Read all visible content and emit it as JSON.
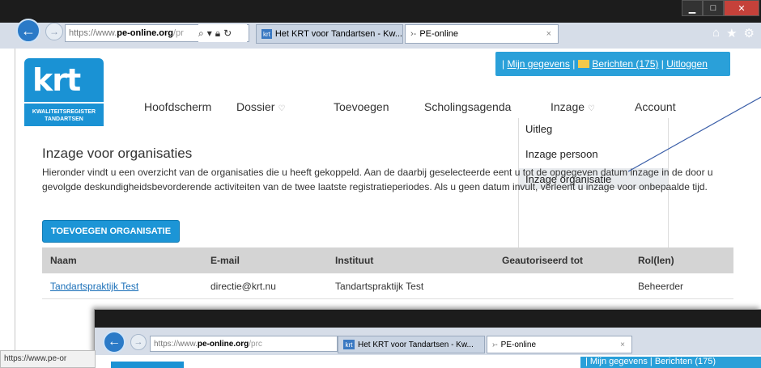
{
  "browser": {
    "address_prefix": "https://www.",
    "address_domain": "pe-online.org",
    "address_suffix": "/pr",
    "tab1_title": "Het KRT voor Tandartsen - Kw...",
    "tab2_title": "PE-online",
    "tab_close": "×",
    "status_url": "https://www.pe-or"
  },
  "header": {
    "links": {
      "my_data": "Mijn gegevens",
      "messages": "Berichten (175)",
      "logout": "Uitloggen",
      "sep": "|"
    },
    "logo": {
      "text": "krt",
      "subtitle_line1": "KWALITEITSREGISTER",
      "subtitle_line2": "TANDARTSEN"
    }
  },
  "nav": {
    "items": [
      {
        "label": "Hoofdscherm"
      },
      {
        "label": "Dossier"
      },
      {
        "label": "Toevoegen"
      },
      {
        "label": "Scholingsagenda"
      },
      {
        "label": "Inzage"
      },
      {
        "label": "Account"
      }
    ],
    "dropdown": [
      {
        "label": "Uitleg"
      },
      {
        "label": "Inzage persoon"
      },
      {
        "label": "Inzage organisatie"
      }
    ]
  },
  "main": {
    "title": "Inzage voor organisaties",
    "paragraph": "Hieronder vindt u een overzicht van de organisaties die u heeft gekoppeld. Aan de daarbij geselecteerde                                        eent u tot de opgegeven datum inzage in de door u gevolgde deskundigheidsbevorderende activiteiten van de twee laatste registratieperiodes. Als u geen datum invult, verleent u inzage voor onbepaalde tijd.",
    "add_button": "TOEVOEGEN ORGANISATIE",
    "table": {
      "headers": [
        "Naam",
        "E-mail",
        "Instituut",
        "Geautoriseerd tot",
        "Rol(len)"
      ],
      "rows": [
        [
          "Tandartspraktijk Test",
          "directie@krt.nu",
          "Tandartspraktijk Test",
          "",
          "Beheerder"
        ]
      ]
    }
  },
  "overlay": {
    "address_prefix": "https://www.",
    "address_domain": "pe-online.org",
    "address_suffix": "/prc",
    "tab1_title": "Het KRT voor Tandartsen - Kw...",
    "tab2_title": "PE-online",
    "tab_close": "×",
    "topbar_text": "| Mijn gegevens | Berichten (175)"
  },
  "icons": {
    "back": "back-arrow-icon",
    "forward": "forward-arrow-icon",
    "search": "search-icon",
    "lock": "lock-icon",
    "refresh": "refresh-icon",
    "home": "home-icon",
    "favorites": "star-icon",
    "settings": "gear-icon",
    "mail": "mail-icon",
    "chevron": "chevron-down-icon"
  },
  "colors": {
    "brand_blue": "#1a92d4",
    "topbar_blue": "#2aa0d9",
    "link_blue": "#1a6fb8",
    "table_header": "#d4d4d4"
  }
}
